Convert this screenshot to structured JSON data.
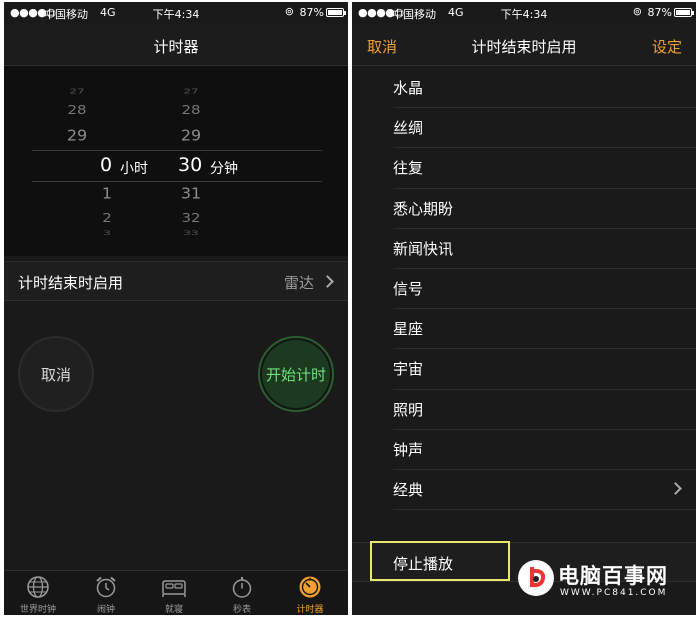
{
  "status_bar": {
    "signal": "●●●●○",
    "carrier": "中国移动",
    "network": "4G",
    "time": "下午4:34",
    "battery_percent": "87%",
    "battery_level": 0.87
  },
  "timer_screen": {
    "title": "计时器",
    "picker": {
      "hours_above": [
        "27",
        "28",
        "29"
      ],
      "selected_hours": "0",
      "hours_unit": "小时",
      "selected_minutes": "30",
      "minutes_unit": "分钟",
      "hours_below": [
        "1",
        "2",
        "3"
      ],
      "minutes_above": [
        "27",
        "28",
        "29"
      ],
      "minutes_below": [
        "31",
        "32",
        "33"
      ]
    },
    "when_timer_ends": {
      "label": "计时结束时启用",
      "value": "雷达"
    },
    "cancel_button": "取消",
    "start_button": "开始计时",
    "tabs": [
      {
        "label": "世界时钟",
        "icon": "globe-icon",
        "active": false
      },
      {
        "label": "闹钟",
        "icon": "alarm-clock-icon",
        "active": false
      },
      {
        "label": "就寝",
        "icon": "bed-icon",
        "active": false
      },
      {
        "label": "秒表",
        "icon": "stopwatch-icon",
        "active": false
      },
      {
        "label": "计时器",
        "icon": "timer-icon",
        "active": true
      }
    ]
  },
  "sound_screen": {
    "cancel": "取消",
    "title": "计时结束时启用",
    "set": "设定",
    "sounds": [
      "水晶",
      "丝绸",
      "往复",
      "悉心期盼",
      "新闻快讯",
      "信号",
      "星座",
      "宇宙",
      "照明",
      "钟声",
      "经典"
    ],
    "stop_playing": "停止播放"
  },
  "watermark": {
    "title": "电脑百事网",
    "url": "WWW.PC841.COM"
  },
  "colors": {
    "accent_orange": "#f0a030",
    "start_green": "#6ee07a",
    "highlight_yellow": "#e8e86a"
  }
}
